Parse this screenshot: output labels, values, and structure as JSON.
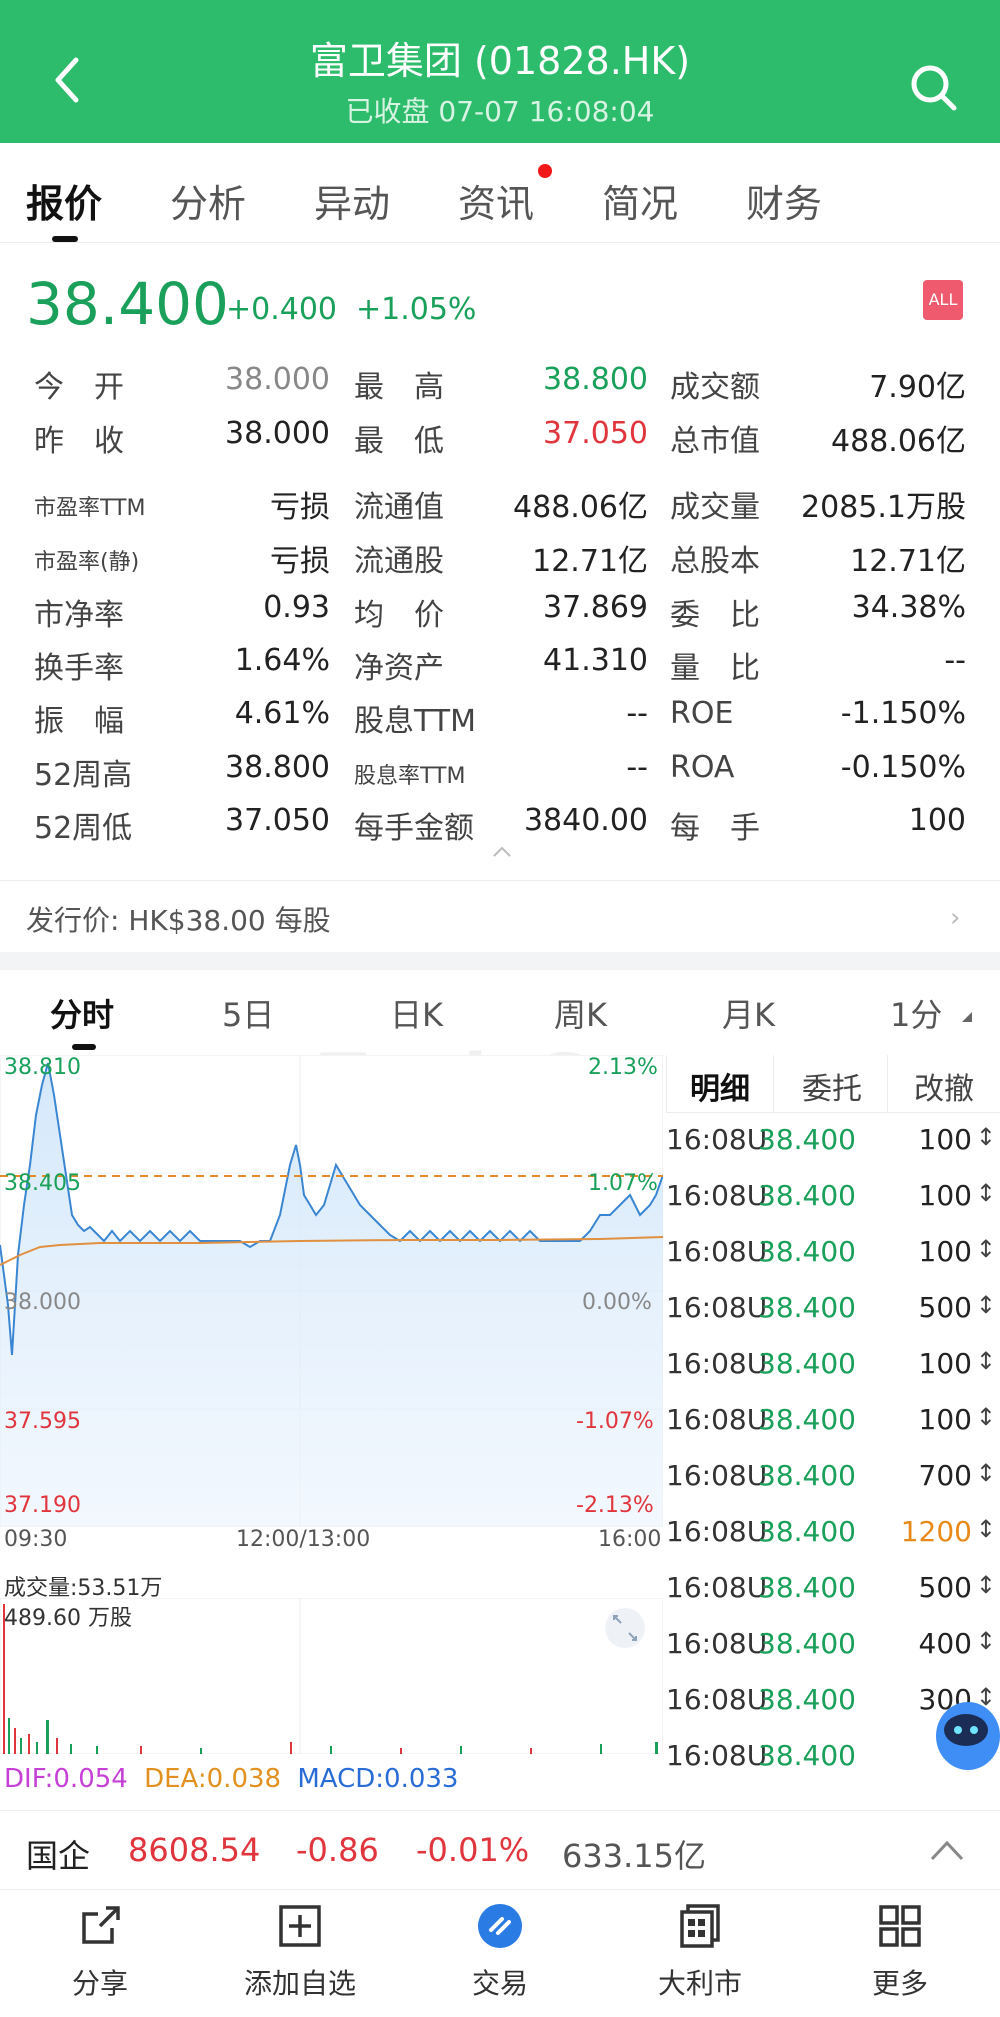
{
  "header": {
    "title": "富卫集团 (01828.HK)",
    "subtitle": "已收盘 07-07 16:08:04"
  },
  "tabs": [
    "报价",
    "分析",
    "异动",
    "资讯",
    "简况",
    "财务"
  ],
  "quote": {
    "price": "38.400",
    "change": "+0.400",
    "change_pct": "+1.05%",
    "badge": "ALL"
  },
  "stats": [
    [
      "今　开",
      "38.000",
      "最　高",
      "38.800",
      "成交额",
      "7.90亿"
    ],
    [
      "昨　收",
      "38.000",
      "最　低",
      "37.050",
      "总市值",
      "488.06亿"
    ],
    [
      "市盈率TTM",
      "亏损",
      "流通值",
      "488.06亿",
      "成交量",
      "2085.1万股"
    ],
    [
      "市盈率(静)",
      "亏损",
      "流通股",
      "12.71亿",
      "总股本",
      "12.71亿"
    ],
    [
      "市净率",
      "0.93",
      "均　价",
      "37.869",
      "委　比",
      "34.38%"
    ],
    [
      "换手率",
      "1.64%",
      "净资产",
      "41.310",
      "量　比",
      "--"
    ],
    [
      "振　幅",
      "4.61%",
      "股息TTM",
      "--",
      "ROE",
      "-1.150%"
    ],
    [
      "52周高",
      "38.800",
      "股息率TTM",
      "--",
      "ROA",
      "-0.150%"
    ],
    [
      "52周低",
      "37.050",
      "每手金额",
      "3840.00",
      "每　手",
      "100"
    ]
  ],
  "issue_price": "发行价: HK$38.00 每股",
  "chart_tabs": [
    "分时",
    "5日",
    "日K",
    "周K",
    "月K",
    "1分"
  ],
  "chart": {
    "y_left": [
      "38.810",
      "38.405",
      "38.000",
      "37.595",
      "37.190"
    ],
    "y_right": [
      "2.13%",
      "1.07%",
      "0.00%",
      "-1.07%",
      "-2.13%"
    ],
    "x_labels": [
      "09:30",
      "12:00/13:00",
      "16:00"
    ],
    "volume_title": "成交量:53.51万",
    "volume_max": "489.60 万股",
    "macd": {
      "dif": "DIF:0.054",
      "dea": "DEA:0.038",
      "macd": "MACD:0.033"
    },
    "watermark": "TradeGo"
  },
  "detail_tabs": [
    "明细",
    "委托",
    "改撤"
  ],
  "details": [
    {
      "time": "16:08U",
      "price": "38.400",
      "vol": "100",
      "highlight": false
    },
    {
      "time": "16:08U",
      "price": "38.400",
      "vol": "100",
      "highlight": false
    },
    {
      "time": "16:08U",
      "price": "38.400",
      "vol": "100",
      "highlight": false
    },
    {
      "time": "16:08U",
      "price": "38.400",
      "vol": "500",
      "highlight": false
    },
    {
      "time": "16:08U",
      "price": "38.400",
      "vol": "100",
      "highlight": false
    },
    {
      "time": "16:08U",
      "price": "38.400",
      "vol": "100",
      "highlight": false
    },
    {
      "time": "16:08U",
      "price": "38.400",
      "vol": "700",
      "highlight": false
    },
    {
      "time": "16:08U",
      "price": "38.400",
      "vol": "1200",
      "highlight": true
    },
    {
      "time": "16:08U",
      "price": "38.400",
      "vol": "500",
      "highlight": false
    },
    {
      "time": "16:08U",
      "price": "38.400",
      "vol": "400",
      "highlight": false
    },
    {
      "time": "16:08U",
      "price": "38.400",
      "vol": "300",
      "highlight": false
    },
    {
      "time": "16:08U",
      "price": "38.400",
      "vol": "",
      "highlight": false
    }
  ],
  "detail_dir_symbol": "↕",
  "index": {
    "name": "国企",
    "value": "8608.54",
    "change": "-0.86",
    "pct": "-0.01%",
    "amount": "633.15亿"
  },
  "toolbar": [
    "分享",
    "添加自选",
    "交易",
    "大利市",
    "更多"
  ],
  "colors": {
    "brand": "#2dbb6c",
    "up": "#1aa05a",
    "down": "#e0353d",
    "highlight": "#e88a1a"
  }
}
